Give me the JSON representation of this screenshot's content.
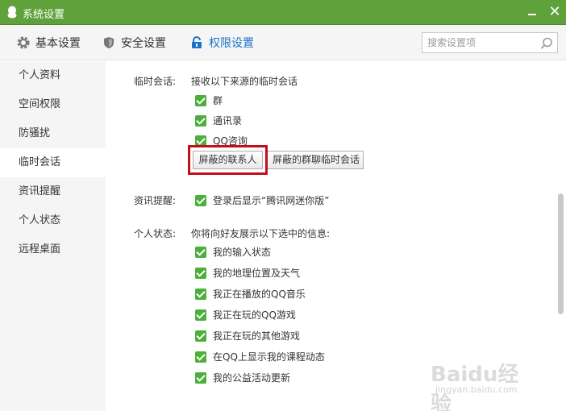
{
  "window": {
    "title": "系统设置",
    "close_glyph": "✕"
  },
  "tabs": [
    {
      "label": "基本设置",
      "icon": "gear-icon"
    },
    {
      "label": "安全设置",
      "icon": "shield-icon"
    },
    {
      "label": "权限设置",
      "icon": "lock-icon",
      "active": true
    }
  ],
  "search": {
    "placeholder": "搜索设置项"
  },
  "sidebar": {
    "items": [
      {
        "label": "个人资料"
      },
      {
        "label": "空间权限"
      },
      {
        "label": "防骚扰"
      },
      {
        "label": "临时会话",
        "active": true
      },
      {
        "label": "资讯提醒"
      },
      {
        "label": "个人状态"
      },
      {
        "label": "远程桌面"
      }
    ]
  },
  "temp_chat": {
    "label": "临时会话:",
    "desc": "接收以下来源的临时会话",
    "options": [
      {
        "label": "群",
        "checked": true
      },
      {
        "label": "通讯录",
        "checked": true
      },
      {
        "label": "QQ咨询",
        "checked": true
      }
    ],
    "btn_blocked_contacts": "屏蔽的联系人",
    "btn_blocked_group": "屏蔽的群聊临时会话"
  },
  "news": {
    "label": "资讯提醒:",
    "option": {
      "label": "登录后显示“腾讯网迷你版”",
      "checked": true
    }
  },
  "status": {
    "label": "个人状态:",
    "desc": "你将向好友展示以下选中的信息:",
    "options": [
      {
        "label": "我的输入状态",
        "checked": true
      },
      {
        "label": "我的地理位置及天气",
        "checked": true
      },
      {
        "label": "我正在播放的QQ音乐",
        "checked": true
      },
      {
        "label": "我正在玩的QQ游戏",
        "checked": true
      },
      {
        "label": "我正在玩的其他游戏",
        "checked": true
      },
      {
        "label": "在QQ上显示我的课程动态",
        "checked": true
      },
      {
        "label": "我的公益活动更新",
        "checked": true
      }
    ]
  },
  "watermark": {
    "line1": "Baidu经验",
    "line2": "jingyan.baidu.com"
  },
  "colors": {
    "titlebar": "#5fa23c",
    "checkbox": "#4caf3a",
    "accent": "#1a73c9",
    "highlight": "#c0101a"
  }
}
